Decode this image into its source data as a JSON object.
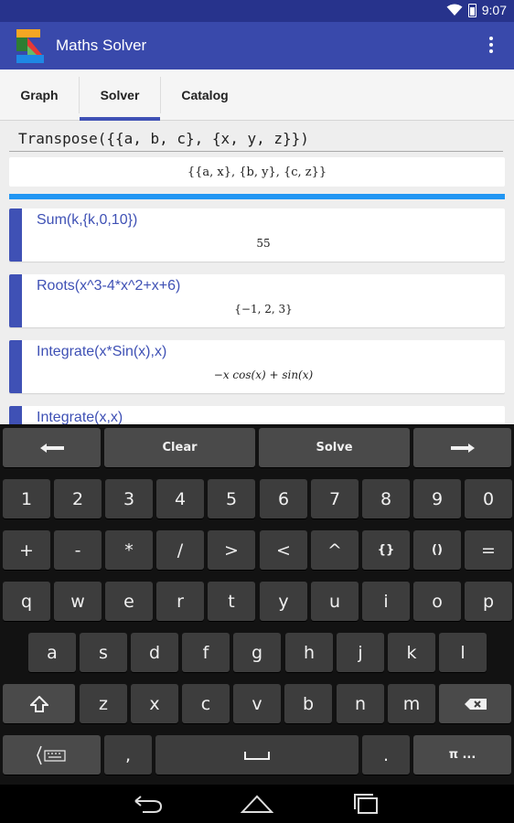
{
  "status": {
    "time": "9:07"
  },
  "app": {
    "title": "Maths Solver",
    "colors": {
      "primary": "#3949ab",
      "accent": "#2196f3",
      "status": "#27338c"
    }
  },
  "tabs": [
    {
      "label": "Graph"
    },
    {
      "label": "Solver"
    },
    {
      "label": "Catalog"
    }
  ],
  "input": {
    "value": "Transpose({{a, b, c}, {x, y, z}})"
  },
  "result": "{{a, x}, {b, y}, {c, z}}",
  "history": [
    {
      "expr": "Sum(k,{k,0,10})",
      "result": "55"
    },
    {
      "expr": "Roots(x^3-4*x^2+x+6)",
      "result": "{−1, 2, 3}"
    },
    {
      "expr": "Integrate(x*Sin(x),x)",
      "result": "−x cos(x) + sin(x)"
    },
    {
      "expr": "Integrate(x,x)",
      "result": ""
    }
  ],
  "keyboard": {
    "top": {
      "clear": "Clear",
      "solve": "Solve"
    },
    "row1": [
      "1",
      "2",
      "3",
      "4",
      "5",
      "6",
      "7",
      "8",
      "9",
      "0"
    ],
    "row2": [
      "+",
      "-",
      "*",
      "/",
      ">",
      "<",
      "^",
      "{}",
      "()",
      "="
    ],
    "row3": [
      "q",
      "w",
      "e",
      "r",
      "t",
      "y",
      "u",
      "i",
      "o",
      "p"
    ],
    "row4": [
      "a",
      "s",
      "d",
      "f",
      "g",
      "h",
      "j",
      "k",
      "l"
    ],
    "row5": [
      "z",
      "x",
      "c",
      "v",
      "b",
      "n",
      "m"
    ],
    "bottom": {
      "comma": ",",
      "period": ".",
      "symbols": "π ..."
    }
  }
}
